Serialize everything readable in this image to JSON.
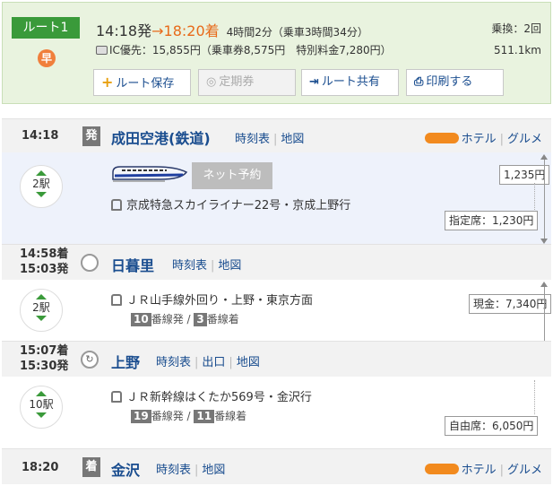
{
  "header": {
    "route_label": "ルート1",
    "haya_icon": "早",
    "dep_time": "14:18発",
    "arrow": "→",
    "arr_time": "18:20着",
    "duration": "4時間2分（乗車3時間34分）",
    "ic_label": "IC優先：15,855円（乗車券8,575円　特別料金7,280円）",
    "transfers": "乗換：2回",
    "distance": "511.1km",
    "buttons": {
      "save": "ルート保存",
      "commuter": "定期券",
      "share": "ルート共有",
      "print": "印刷する"
    }
  },
  "stations": {
    "narita": {
      "time": "14:18",
      "label": "発",
      "name": "成田空港(鉄道)",
      "link1": "時刻表",
      "link2": "地図",
      "hotel": "ホテル",
      "gourmet": "グルメ"
    },
    "nippori": {
      "arr": "14:58着",
      "dep": "15:03発",
      "name": "日暮里",
      "link1": "時刻表",
      "link2": "地図"
    },
    "ueno": {
      "arr": "15:07着",
      "dep": "15:30発",
      "name": "上野",
      "link1": "時刻表",
      "link2": "出口",
      "link3": "地図"
    },
    "kanazawa": {
      "time": "18:20",
      "label": "着",
      "name": "金沢",
      "link1": "時刻表",
      "link2": "地図",
      "hotel": "ホテル",
      "gourmet": "グルメ"
    }
  },
  "segments": {
    "seg1": {
      "stops": "2駅",
      "net_btn": "ネット予約",
      "train": "京成特急スカイライナー22号・京成上野行",
      "fare_top": "1,235円",
      "seat": "指定席：1,230円",
      "line_color": "#f07f3c"
    },
    "seg2": {
      "stops": "2駅",
      "train": "ＪＲ山手線外回り・上野・東京方面",
      "plat_from": "10",
      "plat_from_suffix": "番線発 /",
      "plat_to": "3",
      "plat_to_suffix": "番線着",
      "fare_cash": "現金：7,340円",
      "line_color": "#7fd13b"
    },
    "seg3": {
      "stops": "10駅",
      "train": "ＪＲ新幹線はくたか569号・金沢行",
      "plat_from": "19",
      "plat_from_suffix": "番線発 /",
      "plat_to": "11",
      "plat_to_suffix": "番線着",
      "seat": "自由席：6,050円",
      "line_color": "#2f8f2f"
    }
  }
}
